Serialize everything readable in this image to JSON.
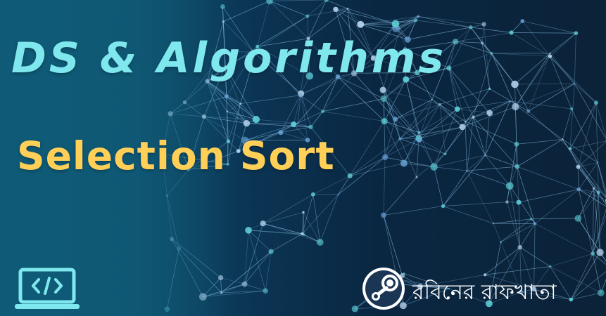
{
  "banner": {
    "title": "DS & Algorithms",
    "subtitle": "Selection Sort",
    "brand_name": "রবিনের রাফখাতা",
    "icons": {
      "code": "code-laptop-icon",
      "brand": "steam-logo-icon"
    }
  },
  "colors": {
    "title": "#7ee8ee",
    "subtitle": "#ffcf57",
    "background_left": "#0f5a76",
    "background_right": "#0b2238",
    "icon": "#7ee8ee"
  }
}
